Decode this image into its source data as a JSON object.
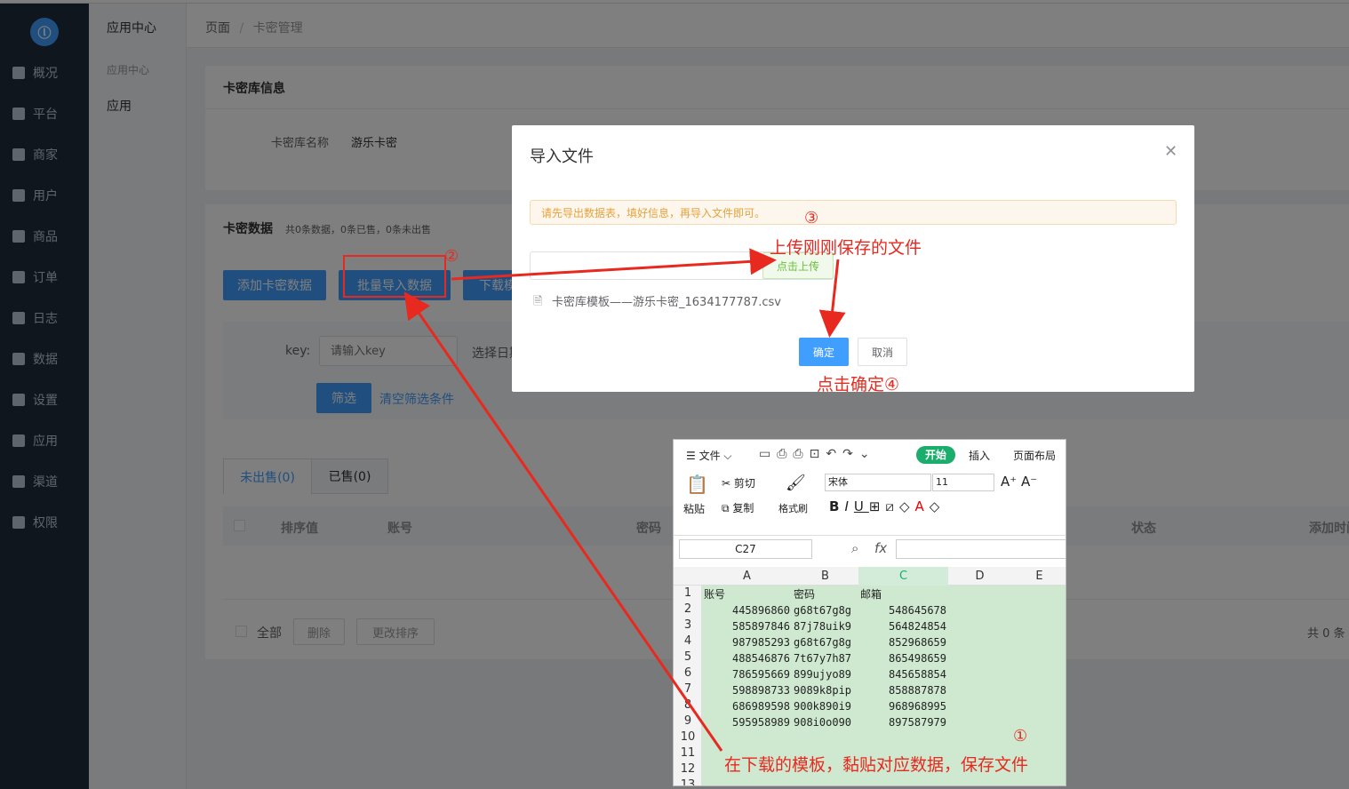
{
  "sidebar": {
    "items": [
      {
        "label": "概况",
        "icon": "monitor-icon"
      },
      {
        "label": "平台",
        "icon": "desktop-icon"
      },
      {
        "label": "商家",
        "icon": "store-icon"
      },
      {
        "label": "用户",
        "icon": "user-icon"
      },
      {
        "label": "商品",
        "icon": "goods-icon"
      },
      {
        "label": "订单",
        "icon": "order-icon"
      },
      {
        "label": "日志",
        "icon": "log-icon"
      },
      {
        "label": "数据",
        "icon": "chart-icon"
      },
      {
        "label": "设置",
        "icon": "gear-icon"
      },
      {
        "label": "应用",
        "icon": "grid-icon"
      },
      {
        "label": "渠道",
        "icon": "cube-icon"
      },
      {
        "label": "权限",
        "icon": "lock-icon"
      }
    ]
  },
  "subsidebar": {
    "title": "应用中心",
    "group": "应用中心",
    "item": "应用"
  },
  "breadcrumb": {
    "root": "页面",
    "sep": "/",
    "current": "卡密管理"
  },
  "info": {
    "title": "卡密库信息",
    "name_label": "卡密库名称",
    "name_value": "游乐卡密"
  },
  "data_section": {
    "title": "卡密数据",
    "summary": "共0条数据，0条已售，0条未出售"
  },
  "buttons": {
    "add": "添加卡密数据",
    "batch_import": "批量导入数据",
    "download": "下载模"
  },
  "filter": {
    "key_label": "key:",
    "key_placeholder": "请输入key",
    "date_label": "选择日期",
    "filter_btn": "筛选",
    "clear_btn": "清空筛选条件"
  },
  "tabs": [
    {
      "label": "未出售(0)"
    },
    {
      "label": "已售(0)"
    }
  ],
  "table": {
    "columns": [
      "排序值",
      "账号",
      "密码",
      "状态",
      "添加时间"
    ]
  },
  "footer": {
    "select_all": "全部",
    "delete": "删除",
    "change_sort": "更改排序",
    "total": "共 0 条"
  },
  "dialog": {
    "title": "导入文件",
    "alert": "请先导出数据表，填好信息，再导入文件即可。",
    "upload_btn": "点击上传",
    "file_name": "卡密库模板——游乐卡密_1634177787.csv",
    "confirm": "确定",
    "cancel": "取消"
  },
  "annotations": {
    "step1": "①",
    "step1_text": "在下载的模板，黏贴对应数据，保存文件",
    "step2": "②",
    "step3": "③",
    "step3_text": "上传刚刚保存的文件",
    "step4_text": "点击确定④"
  },
  "excel": {
    "menu_file": "文件",
    "tab_start": "开始",
    "tab_insert": "插入",
    "tab_layout": "页面布局",
    "paste": "粘贴",
    "cut": "剪切",
    "copy": "复制",
    "format_painter": "格式刷",
    "font": "宋体",
    "size": "11",
    "name_box": "C27",
    "fx": "fx",
    "col_headers": [
      "A",
      "B",
      "C",
      "D",
      "E"
    ],
    "row_numbers": [
      "1",
      "2",
      "3",
      "4",
      "5",
      "6",
      "7",
      "8",
      "9",
      "10",
      "11",
      "12",
      "13"
    ],
    "header_row": [
      "账号",
      "密码",
      "邮箱"
    ],
    "rows": [
      [
        "445896860",
        "g68t67g8g",
        "548645678"
      ],
      [
        "585897846",
        "87j78uik9",
        "564824854"
      ],
      [
        "987985293",
        "g68t67g8g",
        "852968659"
      ],
      [
        "488546876",
        "7t67y7h87",
        "865498659"
      ],
      [
        "786595669",
        "899ujyo89",
        "845658854"
      ],
      [
        "598898733",
        "9089k8pip",
        "858887878"
      ],
      [
        "686989598",
        "900k890i9",
        "968968995"
      ],
      [
        "595958989",
        "908i0o090",
        "897587979"
      ]
    ]
  }
}
